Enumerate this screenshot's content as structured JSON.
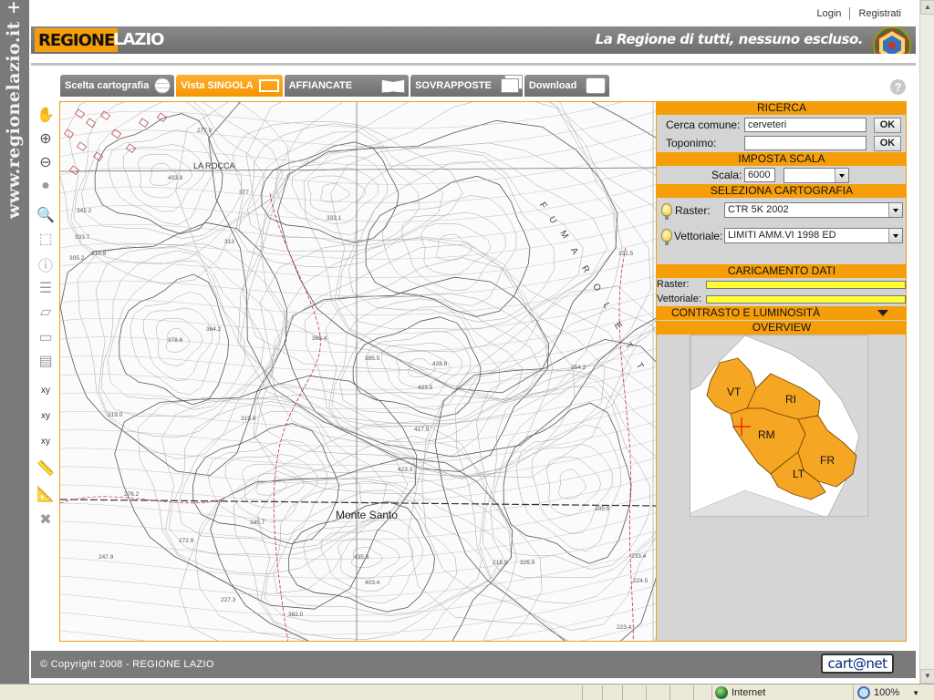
{
  "sidebar_banner": {
    "text": "www.regionelazio.it +"
  },
  "top_links": {
    "login": "Login",
    "register": "Registrati"
  },
  "header": {
    "logo_regione": "REGIONE",
    "logo_lazio": "LAZIO",
    "slogan": "La Regione di tutti, nessuno escluso."
  },
  "tabs": [
    {
      "label": "Scelta cartografia",
      "icon": "globe-grid-icon"
    },
    {
      "label": "Vista SINGOLA",
      "icon": "single-view-icon"
    },
    {
      "label": "AFFIANCATE",
      "icon": "side-by-side-icon"
    },
    {
      "label": "SOVRAPPOSTE",
      "icon": "overlay-icon"
    },
    {
      "label": "Download",
      "icon": "download-icon"
    }
  ],
  "active_tab": "Vista SINGOLA",
  "help": {
    "glyph": "?"
  },
  "toolbar": [
    {
      "name": "pan-hand-icon",
      "glyph": "✋"
    },
    {
      "name": "zoom-in-icon",
      "glyph": "⊕"
    },
    {
      "name": "zoom-out-icon",
      "glyph": "⊖"
    },
    {
      "name": "full-extent-globe-icon",
      "glyph": "●"
    },
    {
      "name": "zoom-previous-icon",
      "glyph": "🔍"
    },
    {
      "name": "zoom-box-icon",
      "glyph": "⬚"
    },
    {
      "name": "info-icon",
      "glyph": "ⓘ"
    },
    {
      "name": "legend-icon",
      "glyph": "☰"
    },
    {
      "name": "layer-icon",
      "glyph": "▱"
    },
    {
      "name": "print-icon",
      "glyph": "▭"
    },
    {
      "name": "bookmark-folder-icon",
      "glyph": "▤"
    },
    {
      "name": "coordinate-input-icon",
      "glyph": "xy"
    },
    {
      "name": "coordinate-pick-icon",
      "glyph": "xy"
    },
    {
      "name": "coordinate-text-icon",
      "glyph": "xy"
    },
    {
      "name": "measure-distance-icon",
      "glyph": "📏"
    },
    {
      "name": "measure-area-icon",
      "glyph": "📐"
    },
    {
      "name": "clear-icon",
      "glyph": "✖"
    }
  ],
  "map": {
    "labels": {
      "la_rocca": "LA ROCCA",
      "monte_santo": "Monte Santo",
      "fumarolett": "FUMAROLETT"
    },
    "elevations": [
      "277.9",
      "403.8",
      "377",
      "342.2",
      "333.7",
      "310.9",
      "305.2",
      "333.1",
      "313",
      "364.2",
      "378.6",
      "368.4",
      "385.5",
      "428.6",
      "423.5",
      "417.9",
      "423.3",
      "319.0",
      "319.9",
      "276.2",
      "272.9",
      "345.7",
      "247.9",
      "227.3",
      "382.0",
      "435.9",
      "403.4",
      "218.9",
      "326.9",
      "331.5",
      "254.2",
      "205.9",
      "233.4",
      "224.5",
      "223.4"
    ]
  },
  "panel": {
    "ricerca": {
      "title": "RICERCA",
      "comune_label": "Cerca comune:",
      "comune_value": "cerveteri",
      "toponimo_label": "Toponimo:",
      "toponimo_value": "",
      "ok_label": "OK"
    },
    "scala": {
      "title": "IMPOSTA SCALA",
      "label": "Scala:",
      "value": "6000",
      "select_value": ""
    },
    "cartografia": {
      "title": "SELEZIONA CARTOGRAFIA",
      "raster_label": "Raster:",
      "raster_value": "CTR  5K 2002",
      "vettoriale_label": "Vettoriale:",
      "vettoriale_value": "LIMITI AMM.VI 1998 ED"
    },
    "caricamento": {
      "title": "CARICAMENTO DATI",
      "raster_label": "Raster:",
      "raster_progress": 1.0,
      "vettoriale_label": "Vettoriale:",
      "vettoriale_progress": 1.0
    },
    "contrasto": {
      "title": "CONTRASTO E LUMINOSITÀ"
    },
    "overview": {
      "title": "OVERVIEW",
      "provinces": [
        "VT",
        "RI",
        "RM",
        "FR",
        "LT"
      ]
    }
  },
  "colors": {
    "accent": "#f59e0a",
    "header_gray": "#7a7a7a",
    "progress": "#ffff33",
    "region": "#f5a623"
  },
  "footer": {
    "copyright": "© Copyright 2008 - REGIONE LAZIO",
    "brand": "cart@net"
  },
  "statusbar": {
    "zone": "Internet",
    "zoom": "100%"
  }
}
